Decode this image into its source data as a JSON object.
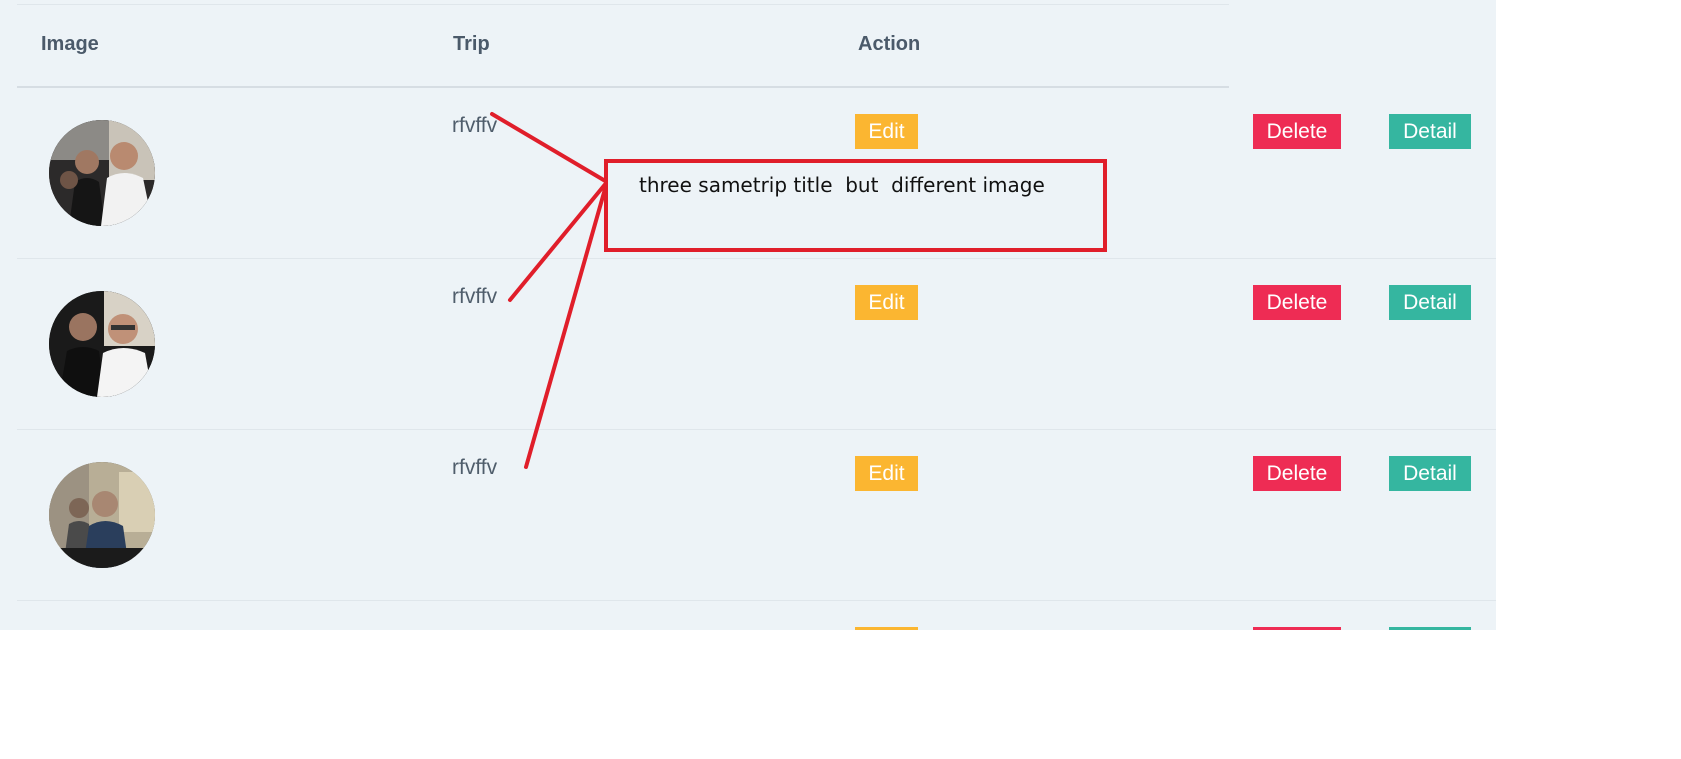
{
  "table": {
    "headers": {
      "image": "Image",
      "trip": "Trip",
      "action": "Action"
    },
    "rows": [
      {
        "trip": "rfvffv",
        "edit_label": "Edit",
        "delete_label": "Delete",
        "detail_label": "Detail"
      },
      {
        "trip": "rfvffv",
        "edit_label": "Edit",
        "delete_label": "Delete",
        "detail_label": "Detail"
      },
      {
        "trip": "rfvffv",
        "edit_label": "Edit",
        "delete_label": "Delete",
        "detail_label": "Detail"
      }
    ]
  },
  "annotation": {
    "text": "three sametrip title  but  different image",
    "color": "#e01e2a"
  },
  "colors": {
    "edit": "#fbb631",
    "delete": "#ee2c54",
    "detail": "#35b6a0",
    "background": "#edf3f7"
  }
}
